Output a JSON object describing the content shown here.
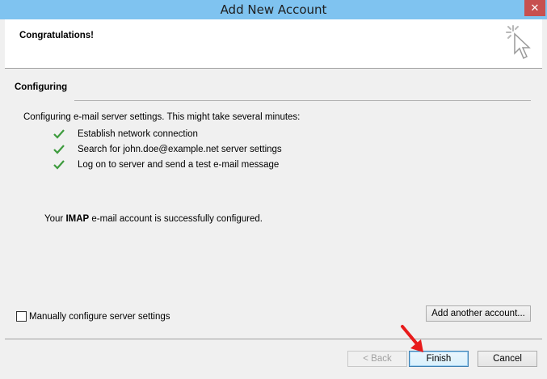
{
  "window": {
    "title": "Add New Account",
    "close_label": "✕"
  },
  "header": {
    "title": "Congratulations!",
    "icon": "wizard-cursor-icon"
  },
  "section": {
    "title": "Configuring",
    "intro": "Configuring e-mail server settings. This might take several minutes:"
  },
  "steps": [
    {
      "label": "Establish network connection",
      "status": "done"
    },
    {
      "label": "Search for john.doe@example.net server settings",
      "status": "done"
    },
    {
      "label": "Log on to server and send a test e-mail message",
      "status": "done"
    }
  ],
  "result": {
    "prefix": "Your ",
    "account_type": "IMAP",
    "suffix": " e-mail account is successfully configured."
  },
  "manual_config": {
    "label": "Manually configure server settings",
    "checked": false
  },
  "buttons": {
    "add_another": "Add another account...",
    "back": "< Back",
    "finish": "Finish",
    "cancel": "Cancel"
  },
  "colors": {
    "titlebar": "#7fc3f0",
    "check": "#3d9b3d",
    "arrow": "#e81b1b"
  }
}
